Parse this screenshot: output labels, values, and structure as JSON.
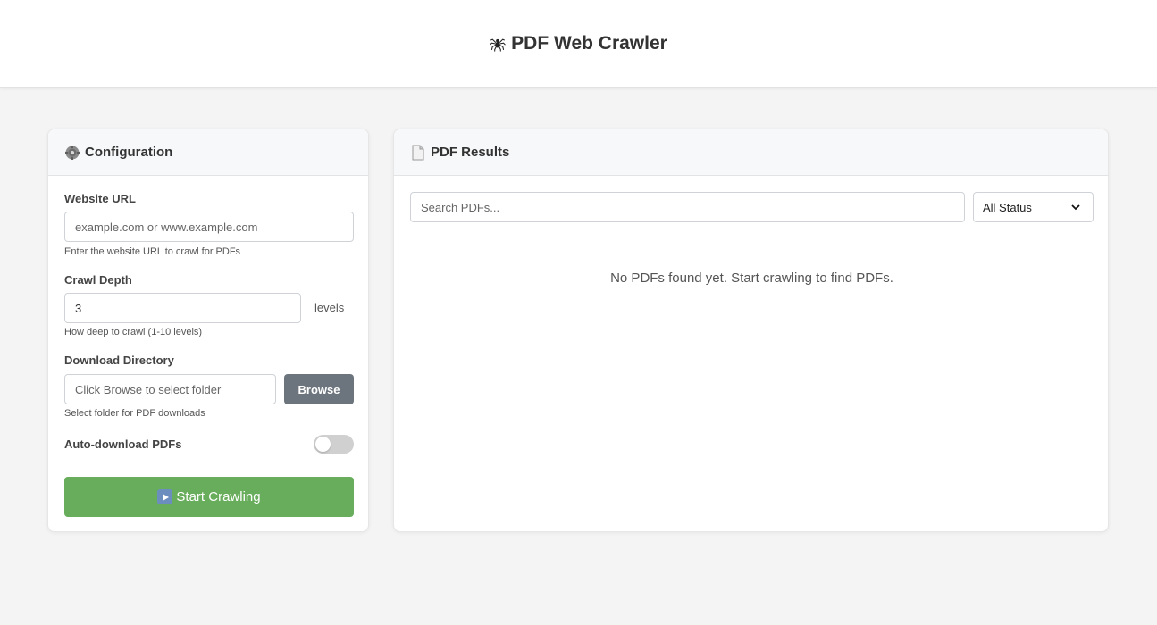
{
  "app": {
    "title": "PDF Web Crawler",
    "title_icon": "spider-icon"
  },
  "config": {
    "header": "Configuration",
    "header_icon": "gear-icon",
    "url": {
      "label": "Website URL",
      "placeholder": "example.com or www.example.com",
      "value": "",
      "hint": "Enter the website URL to crawl for PDFs"
    },
    "depth": {
      "label": "Crawl Depth",
      "value": "3",
      "unit": "levels",
      "hint": "How deep to crawl (1-10 levels)"
    },
    "directory": {
      "label": "Download Directory",
      "placeholder": "Click Browse to select folder",
      "value": "",
      "browse_label": "Browse",
      "hint": "Select folder for PDF downloads"
    },
    "auto_download": {
      "label": "Auto-download PDFs",
      "enabled": false
    },
    "start_button": {
      "label": "Start Crawling",
      "icon": "play-icon"
    }
  },
  "results": {
    "header": "PDF Results",
    "header_icon": "document-icon",
    "search_placeholder": "Search PDFs...",
    "status_filter": {
      "selected": "All Status"
    },
    "empty_message": "No PDFs found yet. Start crawling to find PDFs."
  },
  "colors": {
    "start_button": "#67ad5b",
    "browse_button": "#6c757d",
    "background": "#f4f4f4"
  }
}
